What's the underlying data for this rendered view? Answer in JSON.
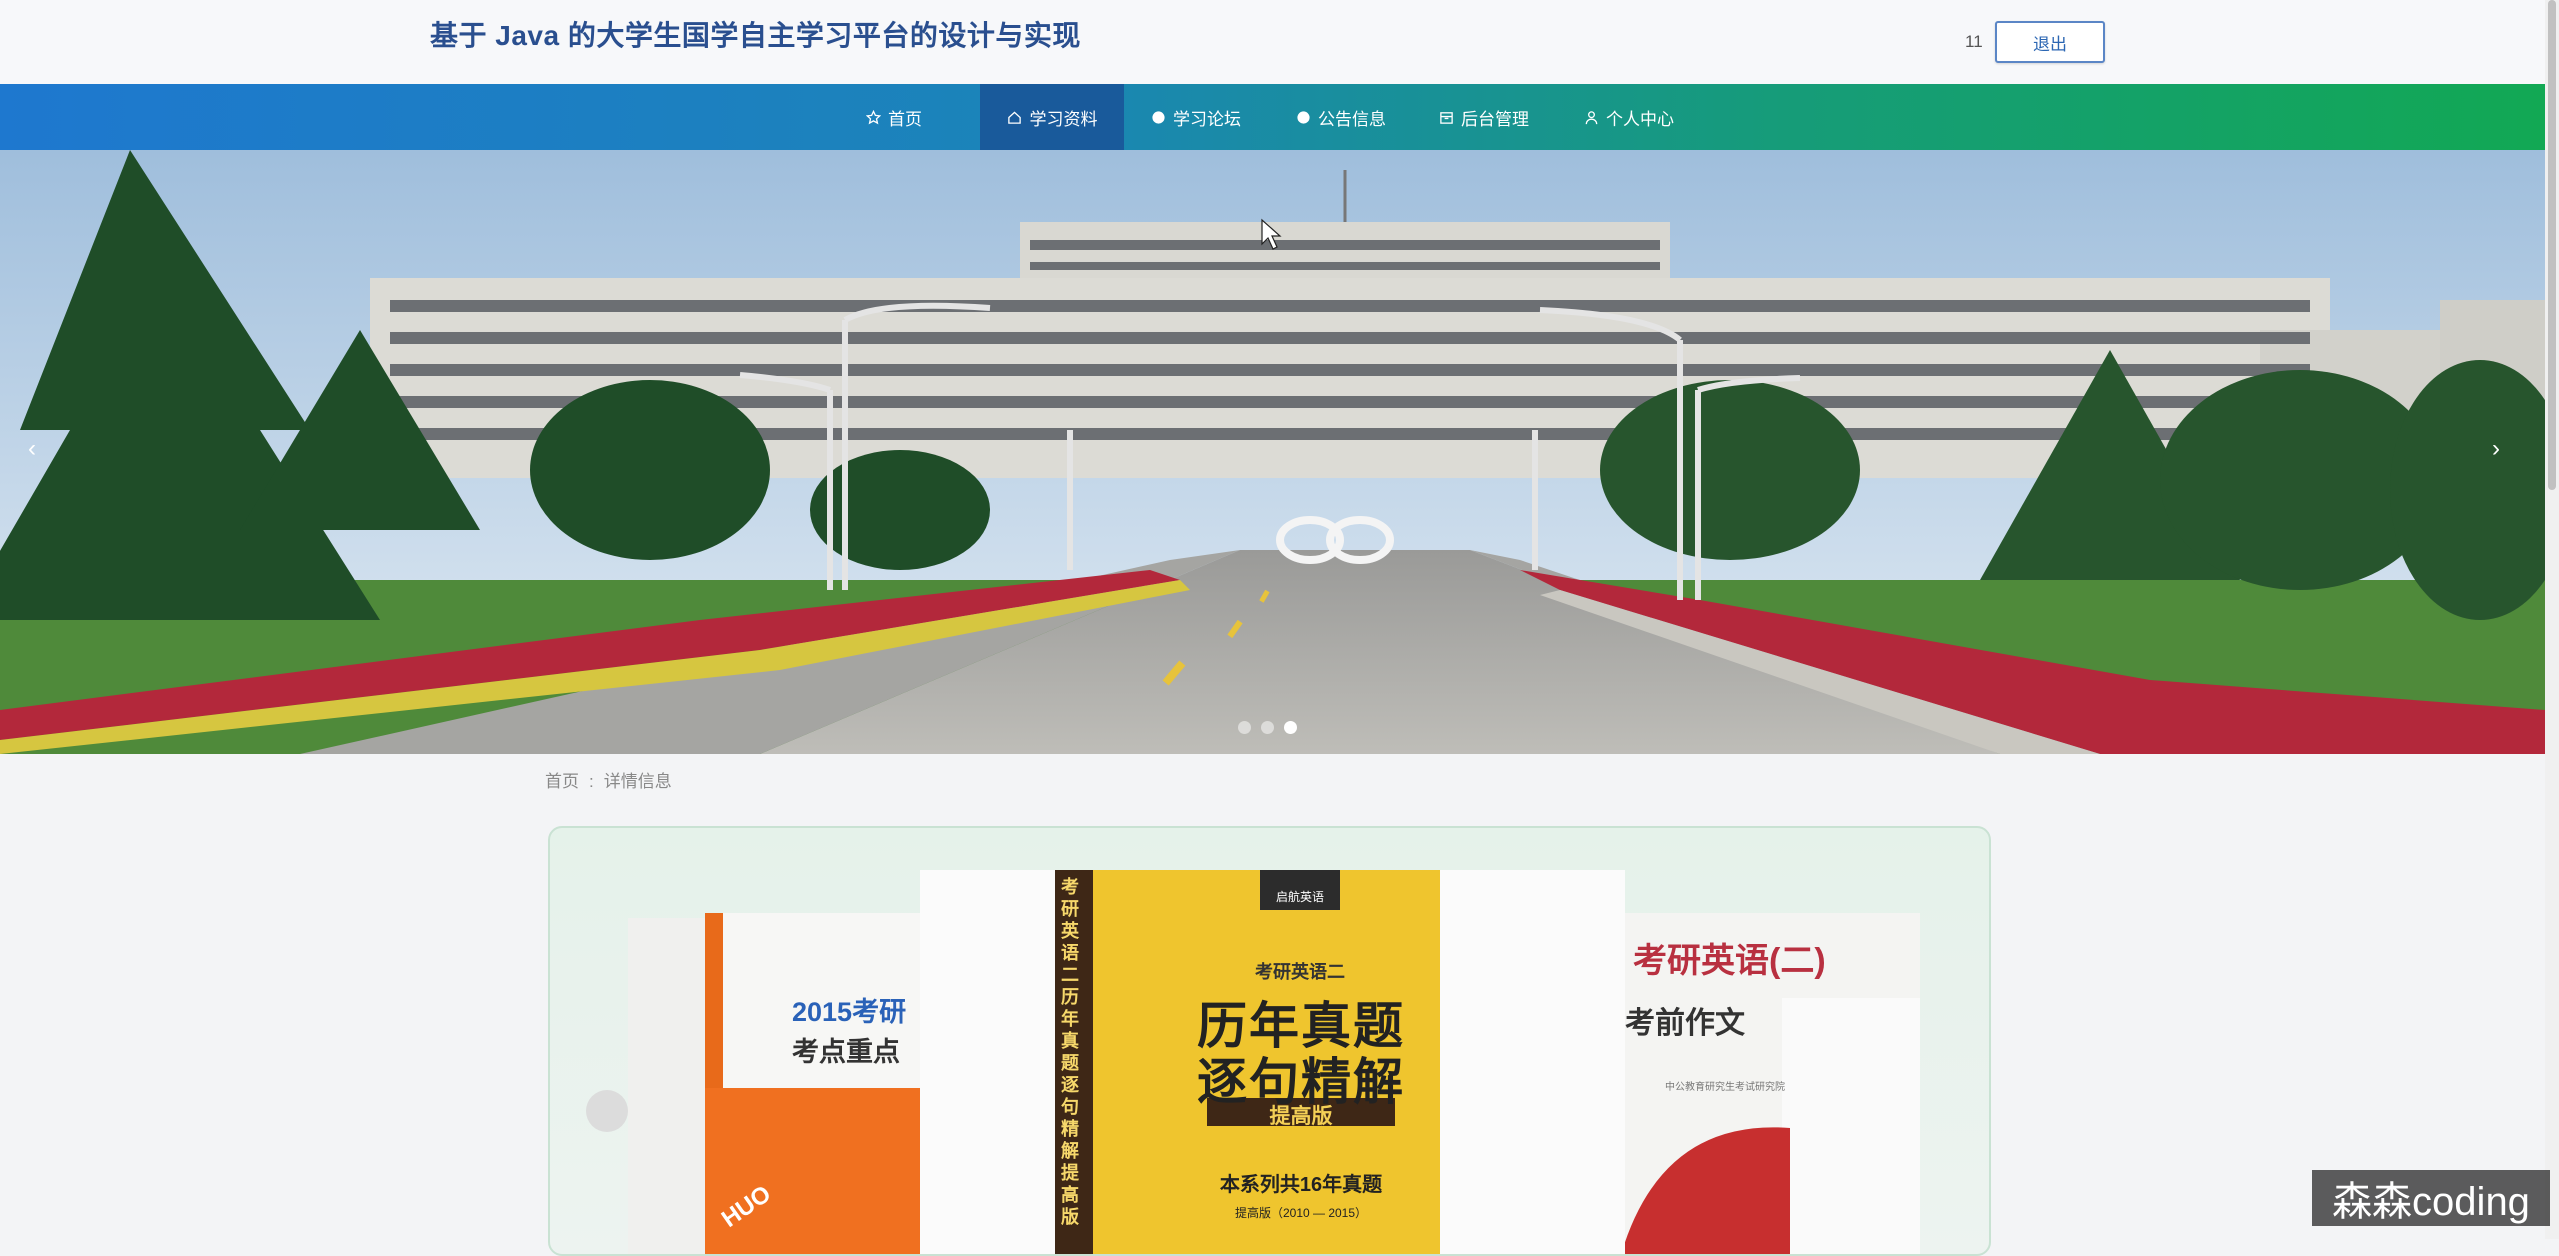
{
  "header": {
    "site_title": "基于 Java 的大学生国学自主学习平台的设计与实现",
    "username": "11",
    "logout_label": "退出"
  },
  "nav": {
    "items": [
      {
        "label": "首页",
        "icon": "star-icon"
      },
      {
        "label": "学习资料",
        "icon": "home-icon",
        "active": true
      },
      {
        "label": "学习论坛",
        "icon": "dot-icon"
      },
      {
        "label": "公告信息",
        "icon": "dot-icon"
      },
      {
        "label": "后台管理",
        "icon": "box-icon"
      },
      {
        "label": "个人中心",
        "icon": "user-icon"
      }
    ],
    "colors": {
      "start": "#1e78cf",
      "end": "#12a854",
      "active": "#195a9b"
    }
  },
  "banner": {
    "slide_count": 3,
    "active_slide": 3,
    "prev_arrow": "‹",
    "next_arrow": "›"
  },
  "breadcrumb": {
    "home": "首页",
    "separator": ":",
    "current": "详情信息"
  },
  "gallery": {
    "books": [
      {
        "line1": "2015考研",
        "line2": "考点重点",
        "badge": "HUO"
      },
      {
        "publisher": "启航英语",
        "spine": "考研英语二 历年真题逐句精解 提高版",
        "subtitle": "考研英语二",
        "title1": "历年真题",
        "title2": "逐句精解",
        "edition": "提高版",
        "series": "本系列共16年真题",
        "years": "提高版（2010 — 2015）"
      },
      {
        "title": "考研英语(二)",
        "subtitle": "考前作文",
        "note": "中公教育研究生考试研究院"
      }
    ]
  },
  "watermark": "森森coding"
}
